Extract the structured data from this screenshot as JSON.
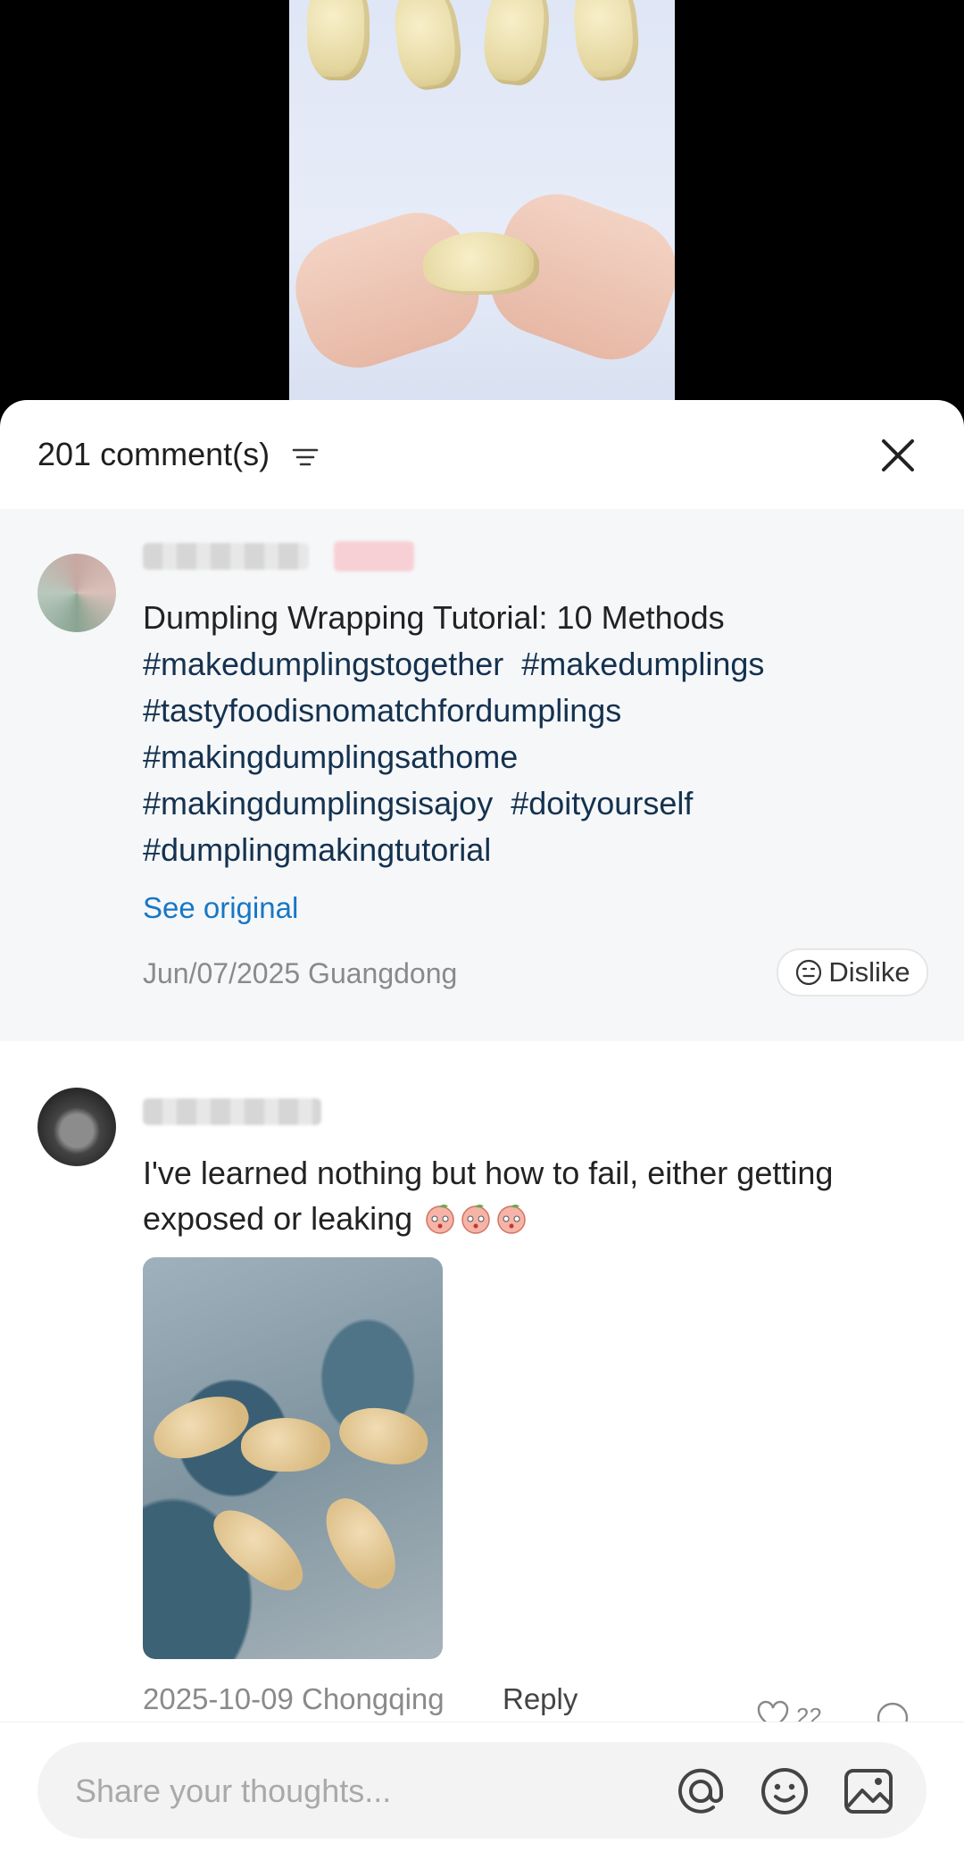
{
  "sheet": {
    "comment_count": "201 comment(s)"
  },
  "post": {
    "title": "Dumpling Wrapping Tutorial: 10 Methods",
    "tags": [
      "#makedumplingstogether",
      "#makedumplings",
      "#tastyfoodisnomatchfordumplings",
      "#makingdumplingsathome",
      "#makingdumplingsisajoy",
      "#doityourself",
      "#dumplingmakingtutorial"
    ],
    "see_original": "See original",
    "date": "Jun/07/2025",
    "location": "Guangdong",
    "dislike_label": "Dislike"
  },
  "comment": {
    "text": "I've learned nothing but how to fail, either getting exposed or leaking",
    "date": "2025-10-09",
    "location": "Chongqing",
    "reply_label": "Reply",
    "like_count": "22"
  },
  "composer": {
    "placeholder": "Share your thoughts..."
  },
  "icons": {
    "sort": "filter-lines-icon",
    "close": "close-icon",
    "dislike": "neutral-face-icon",
    "mention": "at-sign-icon",
    "emoji": "smiley-icon",
    "image": "image-icon",
    "emoji_in_comment": "peach-emoji-icon"
  }
}
